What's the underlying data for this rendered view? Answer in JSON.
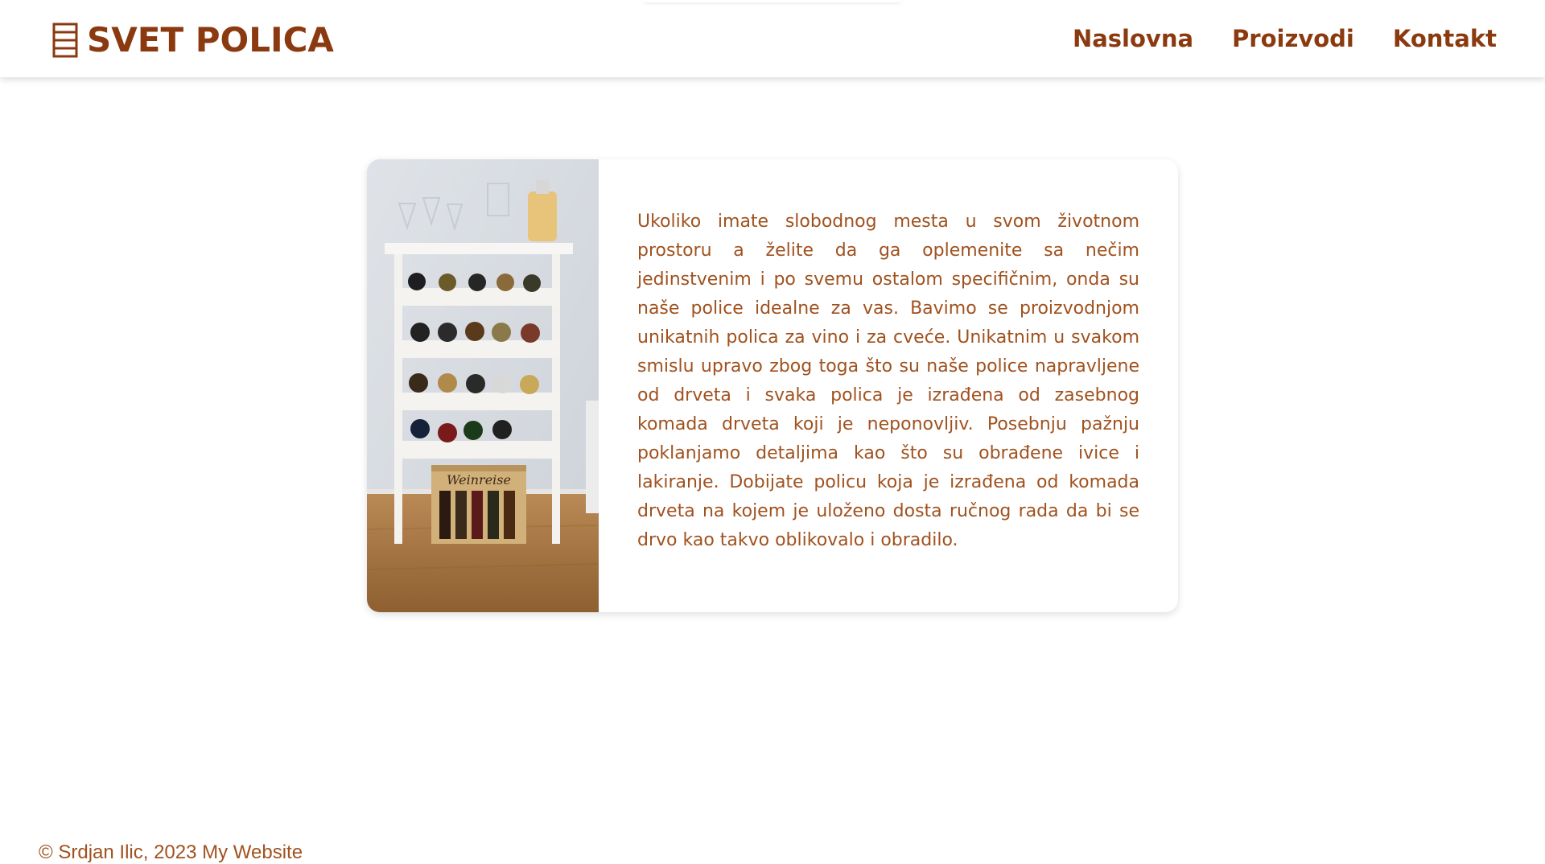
{
  "header": {
    "brand_icon": "shelf-icon",
    "brand": "SVET POLICA",
    "nav": [
      {
        "label": "Naslovna"
      },
      {
        "label": "Proizvodi"
      },
      {
        "label": "Kontakt"
      }
    ]
  },
  "main": {
    "image_icon": "wine-rack-photo",
    "description": "Ukoliko imate slobodnog mesta u svom životnom prostoru a želite da ga oplemenite sa nečim jedinstvenim i po svemu ostalom specifičnim, onda su naše police idealne za vas. Bavimo se proizvodnjom unikatnih polica za vino i za cveće. Unikatnim u svakom smislu upravo zbog toga što su naše police napravljene od drveta i svaka polica je izrađena od zasebnog komada drveta koji je neponovljiv. Posebnju pažnju poklanjamo detaljima kao što su obrađene ivice i lakiranje. Dobijate policu koja je izrađena od komada drveta na kojem je uloženo dosta ručnog rada da bi se drvo kao takvo oblikovalo i obradilo.",
    "box_label": "Weinreise"
  },
  "footer": {
    "text": "© Srdjan Ilic, 2023 My Website"
  },
  "colors": {
    "brand": "#8b3a10",
    "text": "#a0521f"
  }
}
